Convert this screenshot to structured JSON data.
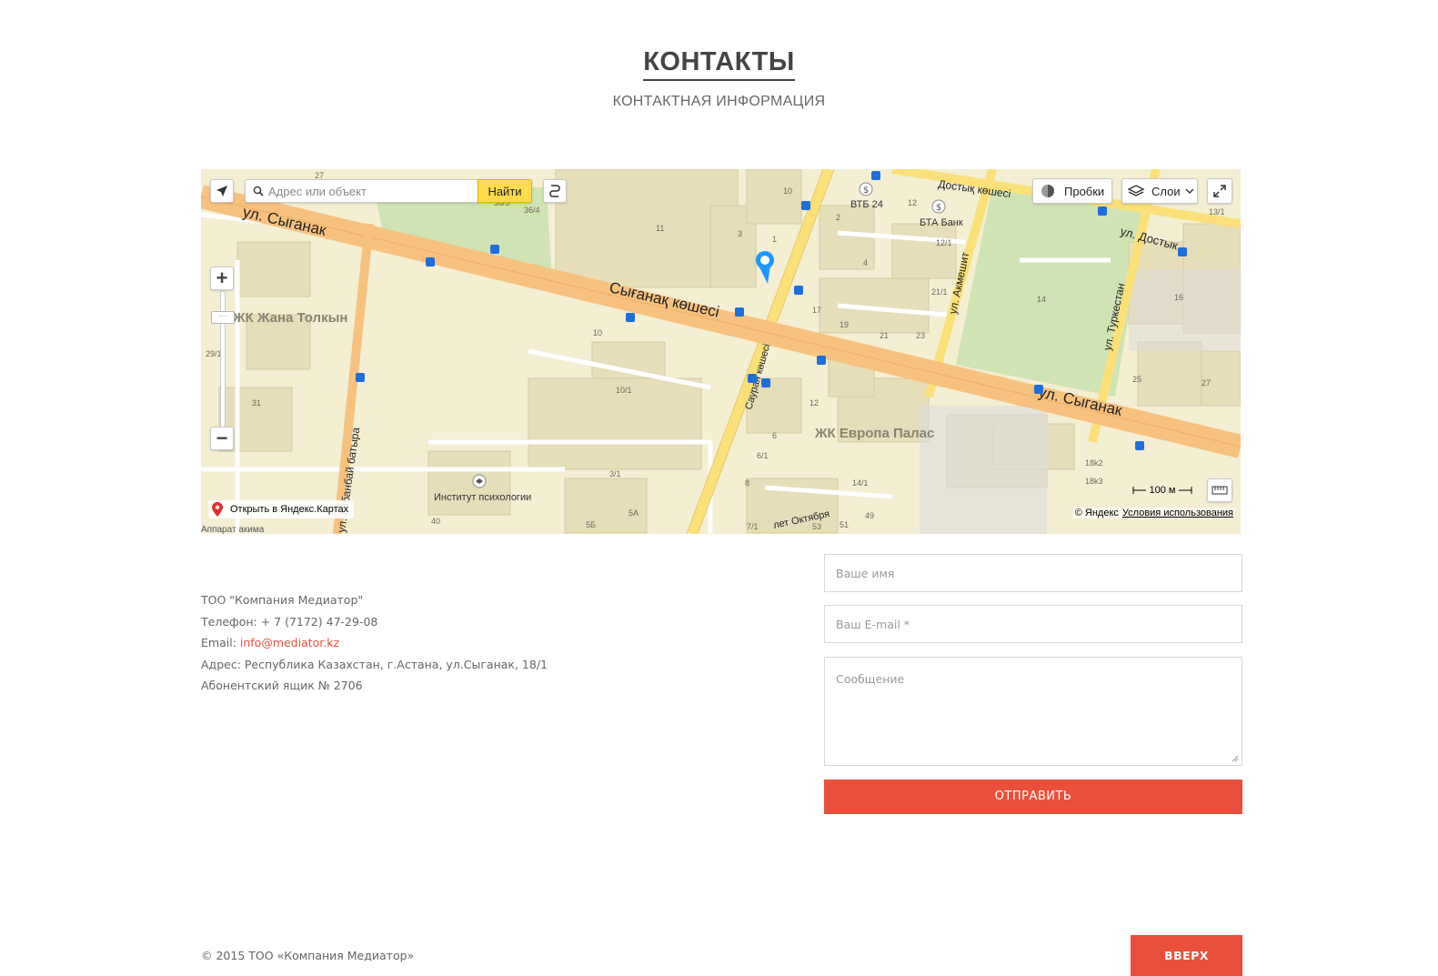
{
  "header": {
    "title": "КОНТАКТЫ",
    "subtitle": "КОНТАКТНАЯ ИНФОРМАЦИЯ"
  },
  "map": {
    "search_placeholder": "Адрес или объект",
    "find_label": "Найти",
    "traffic_label": "Пробки",
    "layers_label": "Слои",
    "open_link": "Открыть в Яндекс.Картах",
    "scale": "100 м",
    "copyright": "© Яндекс",
    "terms": "Условия использования",
    "labels": {
      "street_syganak": "ул. Сыганак",
      "street_syganak_kz": "Сығанақ көшесі",
      "street_syganak2": "ул. Сыганак",
      "street_dostyk_kz": "Достық көшесі",
      "street_dostyk": "ул. Достык",
      "street_akmeshit": "ул. Акмешит",
      "street_turkestan": "ул. Туркестан",
      "street_saury": "Сауран көшесі",
      "street_kabanbay": "ул. Кабанбай батыра",
      "street_oktyabrya": "лет Октября",
      "complex_zhana": "ЖК Жана Толкын",
      "complex_europa": "ЖК Европа Палас",
      "bank_vtb": "ВТБ 24",
      "bank_bta": "БТА Банк",
      "institute": "Институт психологии",
      "akimat": "Аппарат акима"
    },
    "house_numbers": [
      "27",
      "36/3",
      "36/4",
      "11",
      "10",
      "1",
      "3",
      "2",
      "12",
      "4",
      "12/1",
      "21/1",
      "17",
      "19",
      "21",
      "23",
      "14",
      "16",
      "13/1",
      "10",
      "10/1",
      "12",
      "6",
      "6/1",
      "8",
      "3/1",
      "14/1",
      "5A",
      "7/1",
      "53",
      "51",
      "49",
      "25",
      "27",
      "18k2",
      "18k3",
      "29/1",
      "31",
      "40",
      "5Б"
    ]
  },
  "contacts": {
    "company": "ТОО \"Компания Медиатор\"",
    "phone": "Телефон: + 7 (7172) 47-29-08",
    "email_label": "Email: ",
    "email": "info@mediator.kz",
    "address": "Адрес: Республика Казахстан, г.Астана, ул.Сыганак, 18/1",
    "pobox": "Абонентский ящик № 2706"
  },
  "form": {
    "name_placeholder": "Ваше имя",
    "email_placeholder": "Ваш E-mail *",
    "message_placeholder": "Сообщение",
    "submit_label": "ОТПРАВИТЬ"
  },
  "footer": {
    "copyright": "© 2015 ТОО «Компания Медиатор»",
    "top_label": "ВВЕРХ"
  },
  "colors": {
    "accent": "#e9503b",
    "map_bg": "#f4eed3",
    "road_main": "#f7c17f",
    "road_yellow": "#fbe07a",
    "park": "#cfe3b4",
    "marker": "#1e98ff"
  }
}
